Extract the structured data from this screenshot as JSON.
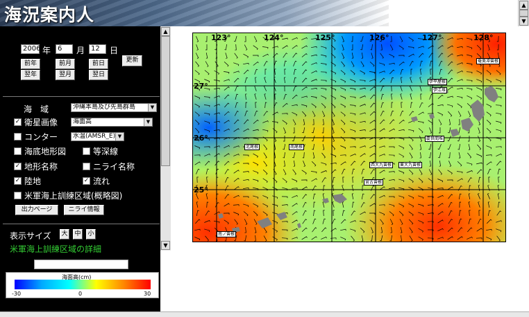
{
  "header": {
    "title": "海況案内人"
  },
  "panel": {
    "date": {
      "year": "2006",
      "year_label": "年",
      "month": "6",
      "month_label": "月",
      "day": "12",
      "day_label": "日"
    },
    "nav_buttons": {
      "prev_year": "前年",
      "prev_month": "前月",
      "prev_day": "前日",
      "next_year": "翌年",
      "next_month": "翌月",
      "next_day": "翌日",
      "update": "更新"
    },
    "area": {
      "label": "海　域",
      "value": "沖縄本島及び先島群島"
    },
    "satellite": {
      "label": "衛星画像",
      "checked": true,
      "value": "海面高"
    },
    "contour": {
      "label": "コンター",
      "checked": false,
      "value": "水温(AMSR_E)"
    },
    "layers": {
      "bathy": {
        "label": "海底地形図",
        "checked": false
      },
      "isobath": {
        "label": "等深線",
        "checked": false
      },
      "place": {
        "label": "地形名称",
        "checked": true
      },
      "nirai": {
        "label": "ニライ名称",
        "checked": false
      },
      "land": {
        "label": "陸地",
        "checked": true
      },
      "flow": {
        "label": "流れ",
        "checked": true
      },
      "usmil": {
        "label": "米軍海上訓練区域(概略図)",
        "checked": false
      }
    },
    "buttons": {
      "output_page": "出力ページ",
      "nirai_info": "ニライ情報"
    },
    "display_size": {
      "label": "表示サイズ",
      "large": "大",
      "medium": "中",
      "small": "小"
    },
    "usmil_detail_link": "米軍海上訓練区域の詳細"
  },
  "legend": {
    "title": "海面高(cm)",
    "min": "-30",
    "mid": "0",
    "max": "30",
    "colors": [
      "#0000ff",
      "#00aaff",
      "#00ffff",
      "#ffff00",
      "#ff8800",
      "#ff0000"
    ]
  },
  "map": {
    "lon_labels": [
      "123°",
      "124°",
      "125°",
      "126°",
      "127°",
      "128°"
    ],
    "lat_labels": [
      "27°",
      "26°",
      "25°"
    ],
    "place_labels": [
      "奄美冲曾根",
      "伊平屋根",
      "伊江堆",
      "慶良間堆",
      "北尾根",
      "南尾根",
      "西大九曾根",
      "東大九曾根",
      "宮古曾根",
      "南ノ曾根"
    ]
  }
}
